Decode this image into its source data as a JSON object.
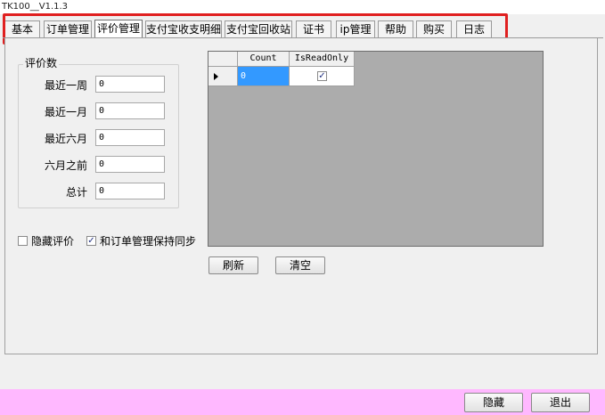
{
  "window": {
    "title": "TK100__V1.1.3"
  },
  "tabs": [
    {
      "label": "基本",
      "active": false
    },
    {
      "label": "订单管理",
      "active": false
    },
    {
      "label": "评价管理",
      "active": true
    },
    {
      "label": "支付宝收支明细",
      "active": false
    },
    {
      "label": "支付宝回收站",
      "active": false
    },
    {
      "label": "证书",
      "active": false
    },
    {
      "label": "ip管理",
      "active": false
    },
    {
      "label": "帮助",
      "active": false
    },
    {
      "label": "购买",
      "active": false
    },
    {
      "label": "日志",
      "active": false
    }
  ],
  "review_count": {
    "group_title": "评价数",
    "rows": [
      {
        "label": "最近一周",
        "value": "0"
      },
      {
        "label": "最近一月",
        "value": "0"
      },
      {
        "label": "最近六月",
        "value": "0"
      },
      {
        "label": "六月之前",
        "value": "0"
      },
      {
        "label": "总计",
        "value": "0"
      }
    ]
  },
  "options": {
    "hide_reviews": {
      "label": "隐藏评价",
      "checked": false
    },
    "sync_orders": {
      "label": "和订单管理保持同步",
      "checked": true
    }
  },
  "grid": {
    "columns": [
      "Count",
      "IsReadOnly"
    ],
    "rows": [
      {
        "Count": "0",
        "IsReadOnly": true
      }
    ]
  },
  "actions": {
    "refresh_label": "刷新",
    "clear_label": "清空"
  },
  "footer": {
    "hide_label": "隐藏",
    "exit_label": "退出"
  },
  "glyphs": {
    "check": "☑",
    "tick": "✓"
  }
}
